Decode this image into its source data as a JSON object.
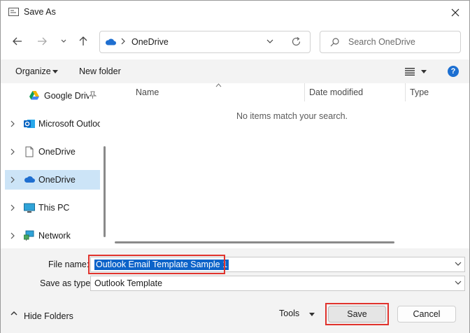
{
  "window": {
    "title": "Save As"
  },
  "address": {
    "location": "OneDrive"
  },
  "search": {
    "placeholder": "Search OneDrive"
  },
  "commands": {
    "organize": "Organize",
    "new_folder": "New folder",
    "help": "?"
  },
  "navigation": {
    "items": [
      {
        "label": "Google Drive",
        "icon": "google-drive-icon",
        "pinned": true
      },
      {
        "label": "Microsoft Outlook",
        "icon": "outlook-icon"
      },
      {
        "label": "OneDrive",
        "icon": "document-icon"
      },
      {
        "label": "OneDrive",
        "icon": "cloud-icon",
        "selected": true
      },
      {
        "label": "This PC",
        "icon": "monitor-icon"
      },
      {
        "label": "Network",
        "icon": "network-icon"
      }
    ]
  },
  "filelist": {
    "columns": [
      "Name",
      "Date modified",
      "Type"
    ],
    "empty_message": "No items match your search."
  },
  "form": {
    "file_name_label": "File name:",
    "file_name_value": "Outlook Email Template Sample 1",
    "save_type_label": "Save as type:",
    "save_type_value": "Outlook Template"
  },
  "footer": {
    "hide_folders": "Hide Folders",
    "tools": "Tools",
    "save": "Save",
    "cancel": "Cancel"
  },
  "colors": {
    "accent": "#0c63c9",
    "highlight": "#e0332d",
    "selected": "#cce4f7"
  }
}
